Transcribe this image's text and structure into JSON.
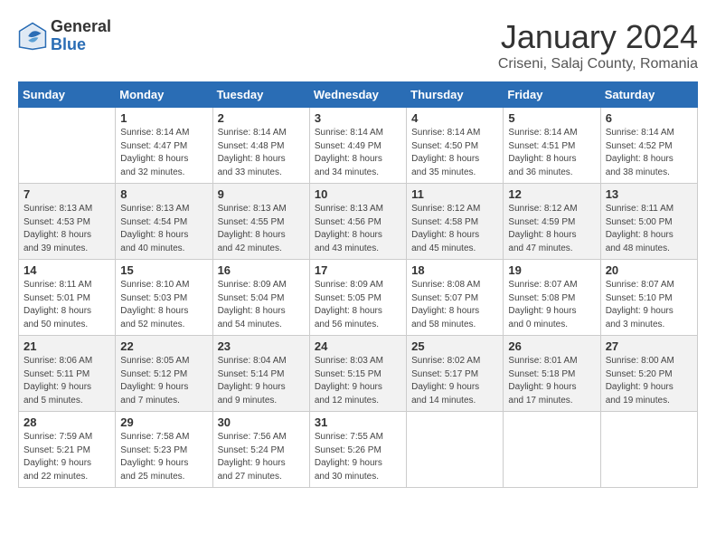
{
  "header": {
    "logo_general": "General",
    "logo_blue": "Blue",
    "month_title": "January 2024",
    "location": "Criseni, Salaj County, Romania"
  },
  "days_of_week": [
    "Sunday",
    "Monday",
    "Tuesday",
    "Wednesday",
    "Thursday",
    "Friday",
    "Saturday"
  ],
  "weeks": [
    [
      {
        "day": "",
        "detail": ""
      },
      {
        "day": "1",
        "detail": "Sunrise: 8:14 AM\nSunset: 4:47 PM\nDaylight: 8 hours\nand 32 minutes."
      },
      {
        "day": "2",
        "detail": "Sunrise: 8:14 AM\nSunset: 4:48 PM\nDaylight: 8 hours\nand 33 minutes."
      },
      {
        "day": "3",
        "detail": "Sunrise: 8:14 AM\nSunset: 4:49 PM\nDaylight: 8 hours\nand 34 minutes."
      },
      {
        "day": "4",
        "detail": "Sunrise: 8:14 AM\nSunset: 4:50 PM\nDaylight: 8 hours\nand 35 minutes."
      },
      {
        "day": "5",
        "detail": "Sunrise: 8:14 AM\nSunset: 4:51 PM\nDaylight: 8 hours\nand 36 minutes."
      },
      {
        "day": "6",
        "detail": "Sunrise: 8:14 AM\nSunset: 4:52 PM\nDaylight: 8 hours\nand 38 minutes."
      }
    ],
    [
      {
        "day": "7",
        "detail": "Sunrise: 8:13 AM\nSunset: 4:53 PM\nDaylight: 8 hours\nand 39 minutes."
      },
      {
        "day": "8",
        "detail": "Sunrise: 8:13 AM\nSunset: 4:54 PM\nDaylight: 8 hours\nand 40 minutes."
      },
      {
        "day": "9",
        "detail": "Sunrise: 8:13 AM\nSunset: 4:55 PM\nDaylight: 8 hours\nand 42 minutes."
      },
      {
        "day": "10",
        "detail": "Sunrise: 8:13 AM\nSunset: 4:56 PM\nDaylight: 8 hours\nand 43 minutes."
      },
      {
        "day": "11",
        "detail": "Sunrise: 8:12 AM\nSunset: 4:58 PM\nDaylight: 8 hours\nand 45 minutes."
      },
      {
        "day": "12",
        "detail": "Sunrise: 8:12 AM\nSunset: 4:59 PM\nDaylight: 8 hours\nand 47 minutes."
      },
      {
        "day": "13",
        "detail": "Sunrise: 8:11 AM\nSunset: 5:00 PM\nDaylight: 8 hours\nand 48 minutes."
      }
    ],
    [
      {
        "day": "14",
        "detail": "Sunrise: 8:11 AM\nSunset: 5:01 PM\nDaylight: 8 hours\nand 50 minutes."
      },
      {
        "day": "15",
        "detail": "Sunrise: 8:10 AM\nSunset: 5:03 PM\nDaylight: 8 hours\nand 52 minutes."
      },
      {
        "day": "16",
        "detail": "Sunrise: 8:09 AM\nSunset: 5:04 PM\nDaylight: 8 hours\nand 54 minutes."
      },
      {
        "day": "17",
        "detail": "Sunrise: 8:09 AM\nSunset: 5:05 PM\nDaylight: 8 hours\nand 56 minutes."
      },
      {
        "day": "18",
        "detail": "Sunrise: 8:08 AM\nSunset: 5:07 PM\nDaylight: 8 hours\nand 58 minutes."
      },
      {
        "day": "19",
        "detail": "Sunrise: 8:07 AM\nSunset: 5:08 PM\nDaylight: 9 hours\nand 0 minutes."
      },
      {
        "day": "20",
        "detail": "Sunrise: 8:07 AM\nSunset: 5:10 PM\nDaylight: 9 hours\nand 3 minutes."
      }
    ],
    [
      {
        "day": "21",
        "detail": "Sunrise: 8:06 AM\nSunset: 5:11 PM\nDaylight: 9 hours\nand 5 minutes."
      },
      {
        "day": "22",
        "detail": "Sunrise: 8:05 AM\nSunset: 5:12 PM\nDaylight: 9 hours\nand 7 minutes."
      },
      {
        "day": "23",
        "detail": "Sunrise: 8:04 AM\nSunset: 5:14 PM\nDaylight: 9 hours\nand 9 minutes."
      },
      {
        "day": "24",
        "detail": "Sunrise: 8:03 AM\nSunset: 5:15 PM\nDaylight: 9 hours\nand 12 minutes."
      },
      {
        "day": "25",
        "detail": "Sunrise: 8:02 AM\nSunset: 5:17 PM\nDaylight: 9 hours\nand 14 minutes."
      },
      {
        "day": "26",
        "detail": "Sunrise: 8:01 AM\nSunset: 5:18 PM\nDaylight: 9 hours\nand 17 minutes."
      },
      {
        "day": "27",
        "detail": "Sunrise: 8:00 AM\nSunset: 5:20 PM\nDaylight: 9 hours\nand 19 minutes."
      }
    ],
    [
      {
        "day": "28",
        "detail": "Sunrise: 7:59 AM\nSunset: 5:21 PM\nDaylight: 9 hours\nand 22 minutes."
      },
      {
        "day": "29",
        "detail": "Sunrise: 7:58 AM\nSunset: 5:23 PM\nDaylight: 9 hours\nand 25 minutes."
      },
      {
        "day": "30",
        "detail": "Sunrise: 7:56 AM\nSunset: 5:24 PM\nDaylight: 9 hours\nand 27 minutes."
      },
      {
        "day": "31",
        "detail": "Sunrise: 7:55 AM\nSunset: 5:26 PM\nDaylight: 9 hours\nand 30 minutes."
      },
      {
        "day": "",
        "detail": ""
      },
      {
        "day": "",
        "detail": ""
      },
      {
        "day": "",
        "detail": ""
      }
    ]
  ]
}
